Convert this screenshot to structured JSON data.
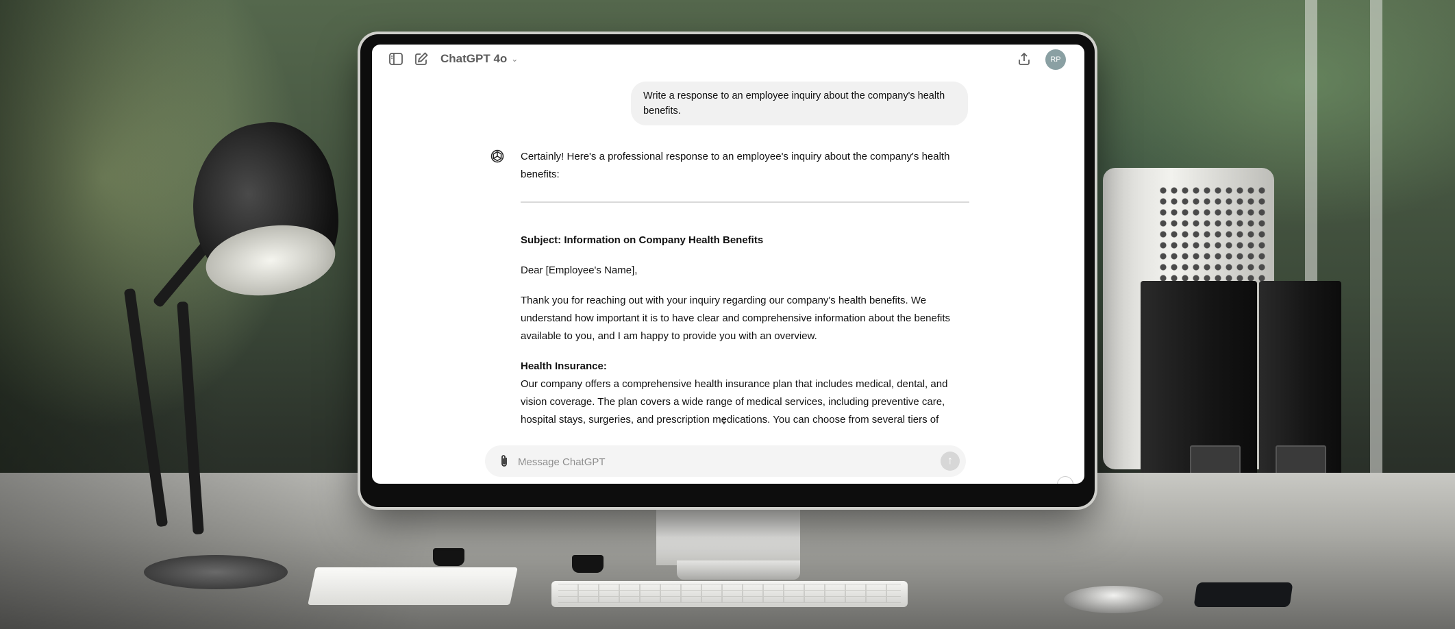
{
  "header": {
    "model_label": "ChatGPT 4o",
    "avatar_initials": "RP"
  },
  "conversation": {
    "user_message": "Write a response to an employee inquiry about the company's health benefits.",
    "assistant": {
      "intro": "Certainly! Here's a professional response to an employee's inquiry about the company's health benefits:",
      "subject": "Subject: Information on Company Health Benefits",
      "greeting": "Dear [Employee's Name],",
      "paragraph_1": "Thank you for reaching out with your inquiry regarding our company's health benefits. We understand how important it is to have clear and comprehensive information about the benefits available to you, and I am happy to provide you with an overview.",
      "section_heading": "Health Insurance:",
      "paragraph_2": "Our company offers a comprehensive health insurance plan that includes medical, dental, and vision coverage. The plan covers a wide range of medical services, including preventive care, hospital stays, surgeries, and prescription medications. You can choose from several tiers of"
    }
  },
  "composer": {
    "placeholder": "Message ChatGPT"
  },
  "icons": {
    "sidebar": "sidebar-toggle-icon",
    "new_chat": "new-chat-icon",
    "share": "share-icon",
    "assistant": "openai-logo-icon",
    "attach": "paperclip-icon",
    "send": "arrow-up-icon",
    "scroll": "arrow-down-icon"
  }
}
